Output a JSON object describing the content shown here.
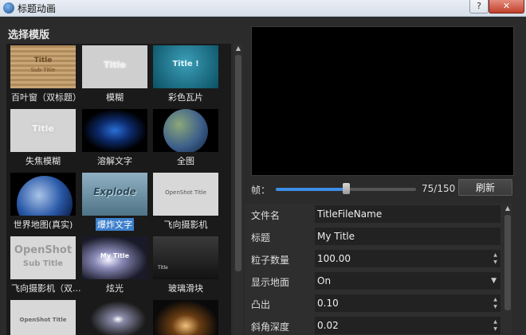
{
  "window": {
    "title": "标题动画",
    "help_glyph": "?",
    "close_glyph": "✕"
  },
  "template_panel": {
    "heading": "选择模版",
    "items": [
      {
        "label": "百叶窗（双标题）",
        "thumb_text": "Title",
        "thumb_sub": "Sub Title",
        "selected": false
      },
      {
        "label": "模糊",
        "thumb_text": "Title",
        "selected": false
      },
      {
        "label": "彩色瓦片",
        "thumb_text": "Title !",
        "selected": false
      },
      {
        "label": "失焦模糊",
        "thumb_text": "Title",
        "selected": false
      },
      {
        "label": "溶解文字",
        "thumb_text": "",
        "selected": false
      },
      {
        "label": "全图",
        "thumb_text": "",
        "selected": false
      },
      {
        "label": "世界地图(真实)",
        "thumb_text": "",
        "selected": false
      },
      {
        "label": "爆炸文字",
        "thumb_text": "Explode",
        "selected": true
      },
      {
        "label": "飞向摄影机",
        "thumb_text": "OpenShot Title",
        "selected": false
      },
      {
        "label": "飞向摄影机（双...",
        "thumb_text": "OpenShot",
        "thumb_sub": "Sub Title",
        "selected": false
      },
      {
        "label": "炫光",
        "thumb_text": "My Title",
        "selected": false
      },
      {
        "label": "玻璃滑块",
        "thumb_text": "Title",
        "selected": false
      },
      {
        "label": "",
        "thumb_text": "OpenShot Title",
        "selected": false
      },
      {
        "label": "",
        "thumb_text": "",
        "selected": false
      },
      {
        "label": "",
        "thumb_text": "",
        "selected": false
      }
    ]
  },
  "preview": {
    "frame_label": "帧：",
    "frame_current": 75,
    "frame_total": 150,
    "frame_text": "75/150",
    "refresh_label": "刷新"
  },
  "properties": [
    {
      "name": "文件名",
      "value": "TitleFileName",
      "control": "text"
    },
    {
      "name": "标题",
      "value": "My Title",
      "control": "text"
    },
    {
      "name": "粒子数量",
      "value": "100.00",
      "control": "spin"
    },
    {
      "name": "显示地面",
      "value": "On",
      "control": "dropdown"
    },
    {
      "name": "凸出",
      "value": "0.10",
      "control": "spin"
    },
    {
      "name": "斜角深度",
      "value": "0.02",
      "control": "spin"
    }
  ],
  "icons": {
    "up_arrow": "▲",
    "down_arrow": "▼",
    "dropdown_arrow": "▼"
  }
}
